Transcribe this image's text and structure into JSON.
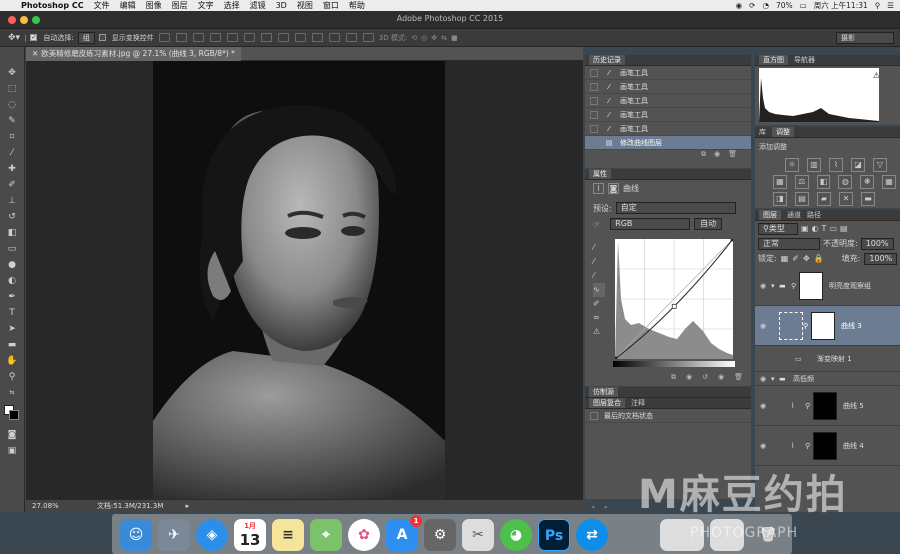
{
  "menubar": {
    "app": "Photoshop CC",
    "items": [
      "文件",
      "编辑",
      "图像",
      "图层",
      "文字",
      "选择",
      "滤镜",
      "3D",
      "视图",
      "窗口",
      "帮助"
    ],
    "battery": "70%",
    "clock": "周六 上午11:31"
  },
  "window": {
    "title": "Adobe Photoshop CC 2015"
  },
  "options": {
    "auto_select_label": "自动选择:",
    "auto_select_value": "组",
    "show_transform_label": "显示变换控件",
    "mode3d_label": "3D 模式:",
    "workspace": "摄影"
  },
  "document": {
    "tab": "欧美精修磨皮练习素材.jpg @ 27.1% (曲线 3, RGB/8*) *",
    "zoom": "27.08%",
    "docsize": "文档:51.3M/231.3M"
  },
  "history": {
    "tab": "历史记录",
    "items": [
      "画笔工具",
      "画笔工具",
      "画笔工具",
      "画笔工具",
      "画笔工具",
      "修改曲线图层"
    ]
  },
  "properties": {
    "tab": "属性",
    "type_label": "曲线",
    "preset_label": "预设:",
    "preset_value": "自定",
    "channel": "RGB",
    "auto_button": "自动"
  },
  "clone_panel": {
    "tab1": "仿制源",
    "tab2": "图层复合",
    "tab3": "注释",
    "state": "最后的文档状态"
  },
  "histogram": {
    "tab1": "直方图",
    "tab2": "导航器",
    "warning": "⚠"
  },
  "adjustments": {
    "tab1": "库",
    "tab2": "调整",
    "title": "添加调整"
  },
  "layers_panel": {
    "tab1": "图层",
    "tab2": "通道",
    "tab3": "路径",
    "filter": "类型",
    "blend": "正常",
    "opacity_label": "不透明度:",
    "opacity": "100%",
    "lock_label": "锁定:",
    "fill_label": "填充:",
    "fill": "100%",
    "layers": [
      {
        "name": "明亮度观察组",
        "kind": "group-masked"
      },
      {
        "name": "曲线 3",
        "kind": "curve",
        "selected": true
      },
      {
        "name": "渐变映射 1",
        "kind": "gradient"
      },
      {
        "name": "高低频",
        "kind": "group"
      },
      {
        "name": "曲线 5",
        "kind": "curve-black"
      },
      {
        "name": "曲线 4",
        "kind": "curve-black"
      }
    ]
  },
  "dock": {
    "calendar_month": "1月",
    "calendar_day": "13",
    "appstore_badge": "1",
    "ps_label": "Ps"
  },
  "watermark": {
    "main": "M麻豆约拍",
    "sub": "PHOTOGRAPH"
  },
  "chart_data": {
    "type": "line",
    "title": "",
    "xlabel": "",
    "ylabel": "",
    "xlim": [
      0,
      255
    ],
    "ylim": [
      0,
      255
    ],
    "series": [
      {
        "values_x": [
          0,
          128,
          255
        ],
        "values_y": [
          0,
          112,
          255
        ]
      }
    ],
    "grid": true
  },
  "colors": {
    "accent": "#6b7c93",
    "panel": "#535353",
    "dark": "#282828"
  }
}
